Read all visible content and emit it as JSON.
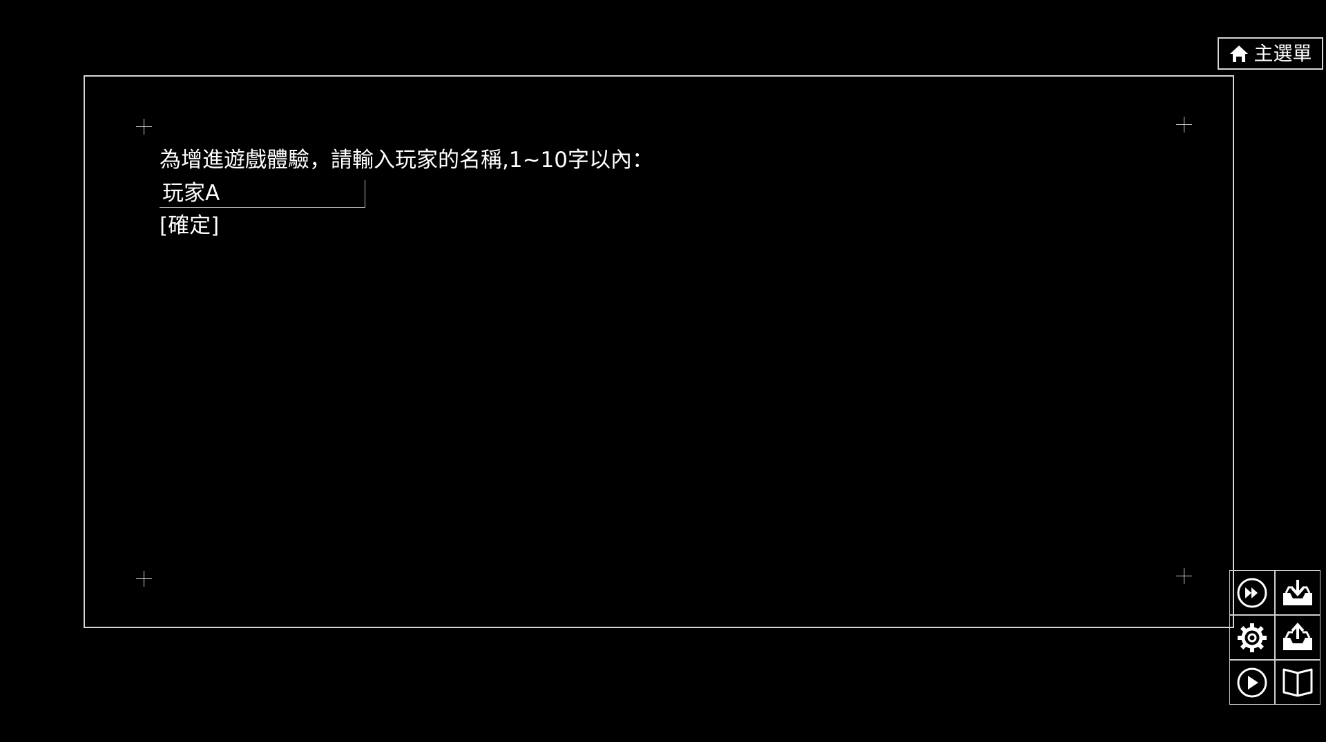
{
  "dialog": {
    "prompt": "為增進遊戲體驗，請輸入玩家的名稱,1~10字以內：",
    "name_input": {
      "value": "玩家A",
      "placeholder": ""
    },
    "confirm_label": "[確定]"
  },
  "top_menu": {
    "icon": "home-icon",
    "label": "主選單"
  },
  "toolbar": {
    "buttons": [
      {
        "icon": "fast-forward-icon"
      },
      {
        "icon": "save-icon"
      },
      {
        "icon": "settings-gear-icon"
      },
      {
        "icon": "load-icon"
      },
      {
        "icon": "play-icon"
      },
      {
        "icon": "book-icon"
      }
    ]
  },
  "colors": {
    "background": "#000000",
    "foreground": "#ffffff",
    "border": "#d8d8d8"
  }
}
